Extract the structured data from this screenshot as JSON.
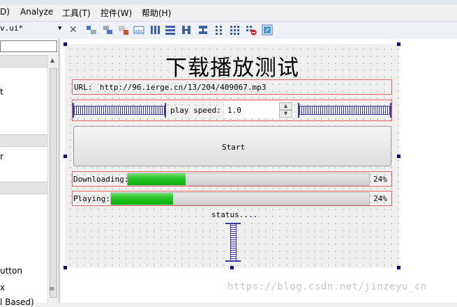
{
  "menu": [
    "D)",
    "Analyze",
    "工具(T)",
    "控件(W)",
    "帮助(H)"
  ],
  "tab_title": "v.ui*",
  "left_panel": {
    "filter_value": "",
    "items": [
      "t",
      "r",
      "utton",
      "x",
      "l Based)"
    ]
  },
  "form": {
    "title": "下载播放测试",
    "url_label": "URL:",
    "url_value": "http://96.ierge.cn/13/204/409067.mp3",
    "speed_label": "play speed:",
    "speed_value": "1.0",
    "start_button": "Start",
    "downloading_label": "Downloading:",
    "downloading_progress": 24,
    "downloading_text": "24%",
    "playing_label": "Playing:",
    "playing_progress": 24,
    "playing_text": "24%",
    "status_text": "status...."
  },
  "watermark": "https://blog.csdn.net/jinzeyu_cn",
  "colors": {
    "progress_fill": "#22c322",
    "layout_border": "#e06060",
    "spring": "#3a3aa6",
    "handle": "#000080"
  }
}
